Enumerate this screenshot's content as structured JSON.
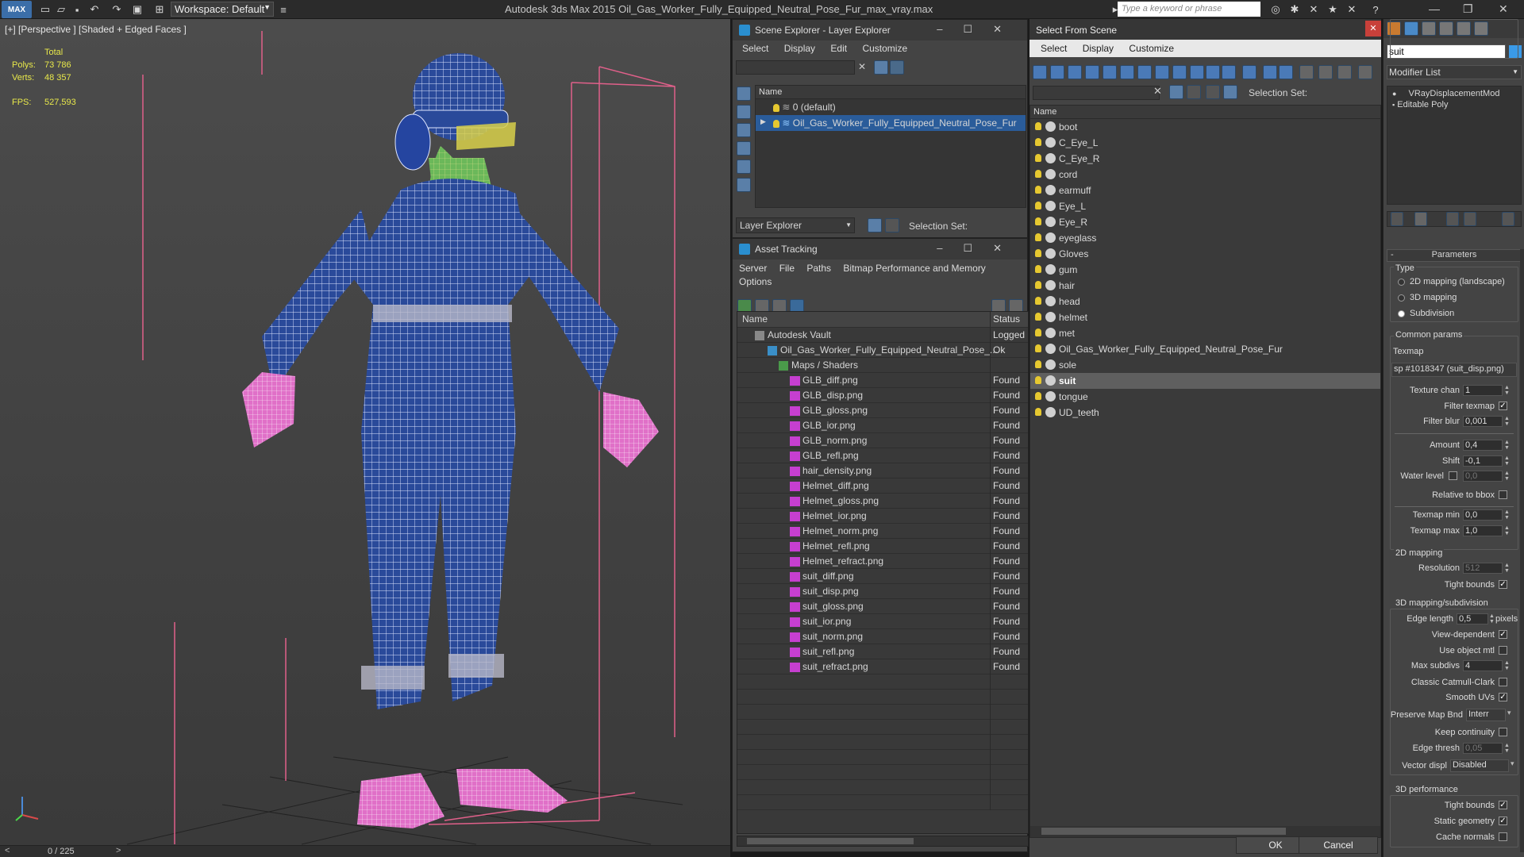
{
  "titlebar": {
    "logo": "MAX",
    "workspace": "Workspace: Default",
    "app_title": "Autodesk 3ds Max  2015    Oil_Gas_Worker_Fully_Equipped_Neutral_Pose_Fur_max_vray.max",
    "search_placeholder": "Type a keyword or phrase"
  },
  "viewport": {
    "label": "[+] [Perspective ] [Shaded + Edged Faces ]",
    "stats": {
      "total_label": "Total",
      "polys_label": "Polys:",
      "polys": "73 786",
      "verts_label": "Verts:",
      "verts": "48 357",
      "fps_label": "FPS:",
      "fps": "527,593"
    }
  },
  "timeline": {
    "frame": "0 / 225"
  },
  "scene_explorer": {
    "title": "Scene Explorer - Layer Explorer",
    "menu": [
      "Select",
      "Display",
      "Edit",
      "Customize"
    ],
    "column": "Name",
    "layers": [
      "0 (default)",
      "Oil_Gas_Worker_Fully_Equipped_Neutral_Pose_Fur"
    ],
    "footer_dropdown": "Layer Explorer",
    "selection_set_label": "Selection Set:"
  },
  "asset_tracking": {
    "title": "Asset Tracking",
    "menu": [
      "Server",
      "File",
      "Paths",
      "Bitmap Performance and Memory",
      "Options"
    ],
    "columns": {
      "name": "Name",
      "status": "Status"
    },
    "rows": [
      {
        "name": "Autodesk Vault",
        "status": "Logged",
        "indent": 1
      },
      {
        "name": "Oil_Gas_Worker_Fully_Equipped_Neutral_Pose_...",
        "status": "Ok",
        "indent": 2
      },
      {
        "name": "Maps / Shaders",
        "status": "",
        "indent": 3
      },
      {
        "name": "GLB_diff.png",
        "status": "Found",
        "indent": 4
      },
      {
        "name": "GLB_disp.png",
        "status": "Found",
        "indent": 4
      },
      {
        "name": "GLB_gloss.png",
        "status": "Found",
        "indent": 4
      },
      {
        "name": "GLB_ior.png",
        "status": "Found",
        "indent": 4
      },
      {
        "name": "GLB_norm.png",
        "status": "Found",
        "indent": 4
      },
      {
        "name": "GLB_refl.png",
        "status": "Found",
        "indent": 4
      },
      {
        "name": "hair_density.png",
        "status": "Found",
        "indent": 4
      },
      {
        "name": "Helmet_diff.png",
        "status": "Found",
        "indent": 4
      },
      {
        "name": "Helmet_gloss.png",
        "status": "Found",
        "indent": 4
      },
      {
        "name": "Helmet_ior.png",
        "status": "Found",
        "indent": 4
      },
      {
        "name": "Helmet_norm.png",
        "status": "Found",
        "indent": 4
      },
      {
        "name": "Helmet_refl.png",
        "status": "Found",
        "indent": 4
      },
      {
        "name": "Helmet_refract.png",
        "status": "Found",
        "indent": 4
      },
      {
        "name": "suit_diff.png",
        "status": "Found",
        "indent": 4
      },
      {
        "name": "suit_disp.png",
        "status": "Found",
        "indent": 4
      },
      {
        "name": "suit_gloss.png",
        "status": "Found",
        "indent": 4
      },
      {
        "name": "suit_ior.png",
        "status": "Found",
        "indent": 4
      },
      {
        "name": "suit_norm.png",
        "status": "Found",
        "indent": 4
      },
      {
        "name": "suit_refl.png",
        "status": "Found",
        "indent": 4
      },
      {
        "name": "suit_refract.png",
        "status": "Found",
        "indent": 4
      }
    ]
  },
  "select_from_scene": {
    "title": "Select From Scene",
    "menu": [
      "Select",
      "Display",
      "Customize"
    ],
    "selection_set_label": "Selection Set:",
    "column": "Name",
    "items": [
      "boot",
      "C_Eye_L",
      "C_Eye_R",
      "cord",
      "earmuff",
      "Eye_L",
      "Eye_R",
      "eyeglass",
      "Gloves",
      "gum",
      "hair",
      "head",
      "helmet",
      "met",
      "Oil_Gas_Worker_Fully_Equipped_Neutral_Pose_Fur",
      "sole",
      "suit",
      "tongue",
      "UD_teeth"
    ],
    "selected": "suit",
    "ok_label": "OK",
    "cancel_label": "Cancel"
  },
  "command_panel": {
    "object_name": "suit",
    "modifier_list": "Modifier List",
    "stack": [
      "VRayDisplacementMod",
      "Editable Poly"
    ],
    "params": {
      "rollout": "Parameters",
      "type_label": "Type",
      "type_options": [
        "2D mapping (landscape)",
        "3D mapping",
        "Subdivision"
      ],
      "type_selected": "Subdivision",
      "common_label": "Common params",
      "texmap_label": "Texmap",
      "texmap_value": "sp #1018347 (suit_disp.png)",
      "texture_chan_label": "Texture chan",
      "texture_chan": "1",
      "filter_texmap_label": "Filter texmap",
      "filter_blur_label": "Filter blur",
      "filter_blur": "0,001",
      "amount_label": "Amount",
      "amount": "0,4",
      "shift_label": "Shift",
      "shift": "-0,1",
      "water_level_label": "Water level",
      "water_level": "0,0",
      "relative_bbox_label": "Relative to bbox",
      "texmap_min_label": "Texmap min",
      "texmap_min": "0,0",
      "texmap_max_label": "Texmap max",
      "texmap_max": "1,0",
      "map2d_label": "2D mapping",
      "resolution_label": "Resolution",
      "resolution": "512",
      "tight_bounds_label": "Tight bounds",
      "map3d_label": "3D mapping/subdivision",
      "edge_length_label": "Edge length",
      "edge_length": "0,5",
      "pixels_label": "pixels",
      "view_dependent_label": "View-dependent",
      "use_object_mtl_label": "Use object mtl",
      "max_subdivs_label": "Max subdivs",
      "max_subdivs": "4",
      "catmull_label": "Classic Catmull-Clark",
      "smooth_uvs_label": "Smooth UVs",
      "preserve_label": "Preserve Map Bnd",
      "preserve_value": "Interr",
      "keep_cont_label": "Keep continuity",
      "edge_thresh_label": "Edge thresh",
      "edge_thresh": "0,05",
      "vector_disp_label": "Vector displ",
      "vector_disp_value": "Disabled",
      "perf_label": "3D performance",
      "tight_bounds2_label": "Tight bounds",
      "static_geom_label": "Static geometry",
      "cache_normals_label": "Cache normals"
    }
  }
}
